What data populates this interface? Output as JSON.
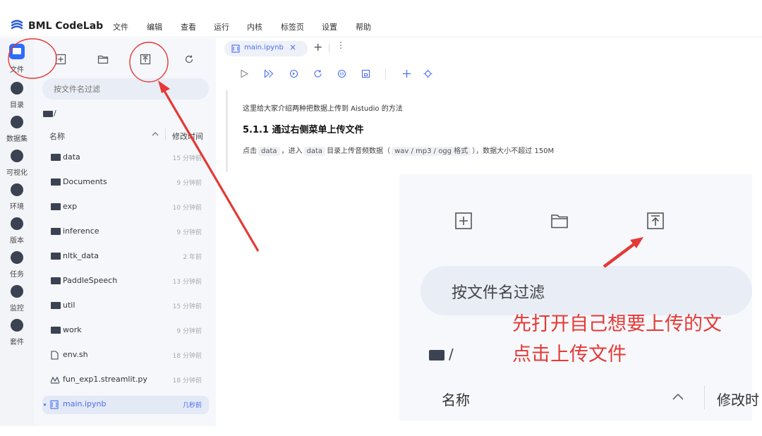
{
  "app": {
    "title": "BML CodeLab"
  },
  "menu": [
    "文件",
    "编辑",
    "查看",
    "运行",
    "内核",
    "标签页",
    "设置",
    "帮助"
  ],
  "rail": [
    {
      "label": "文件",
      "icon": "folder-icon"
    },
    {
      "label": "目录",
      "icon": "toc-icon"
    },
    {
      "label": "数据集",
      "icon": "dataset-icon"
    },
    {
      "label": "可视化",
      "icon": "chart-icon"
    },
    {
      "label": "环境",
      "icon": "environment-icon"
    },
    {
      "label": "版本",
      "icon": "version-icon"
    },
    {
      "label": "任务",
      "icon": "task-icon"
    },
    {
      "label": "监控",
      "icon": "monitor-icon"
    },
    {
      "label": "套件",
      "icon": "suite-icon"
    }
  ],
  "filebrowser": {
    "filter_placeholder": "按文件名过滤",
    "path": "/",
    "col_name": "名称",
    "col_modified": "修改时间",
    "files": [
      {
        "name": "data",
        "time": "15 分钟前",
        "type": "folder"
      },
      {
        "name": "Documents",
        "time": "9 分钟前",
        "type": "folder"
      },
      {
        "name": "exp",
        "time": "10 分钟前",
        "type": "folder"
      },
      {
        "name": "inference",
        "time": "9 分钟前",
        "type": "folder"
      },
      {
        "name": "nltk_data",
        "time": "2 年前",
        "type": "folder"
      },
      {
        "name": "PaddleSpeech",
        "time": "13 分钟前",
        "type": "folder"
      },
      {
        "name": "util",
        "time": "15 分钟前",
        "type": "folder"
      },
      {
        "name": "work",
        "time": "9 分钟前",
        "type": "folder"
      },
      {
        "name": "env.sh",
        "time": "18 分钟前",
        "type": "file"
      },
      {
        "name": "fun_exp1.streamlit.py",
        "time": "18 分钟前",
        "type": "streamlit"
      },
      {
        "name": "main.ipynb",
        "time": "几秒前",
        "type": "notebook"
      }
    ]
  },
  "tab": {
    "label": "main.ipynb"
  },
  "notebook": {
    "intro": "这里给大家介绍两种把数据上传到 Aistudio 的方法",
    "heading": "5.1.1 通过右侧菜单上传文件",
    "desc_1": "点击",
    "desc_code1": "data",
    "desc_2": "，进入",
    "desc_code2": "data",
    "desc_3": "目录上传音频数据（",
    "desc_code3": "wav / mp3 / ogg 格式",
    "desc_4": "），数据大小不超过 150M"
  },
  "embedded": {
    "filter_placeholder": "按文件名过滤",
    "path": "/",
    "annotation_line1": "先打开自己想要上传的文",
    "annotation_line2": "点击上传文件",
    "col_name": "名称",
    "col_modified": "修改时"
  },
  "colors": {
    "accent": "#4a6cf7",
    "annotation": "#e53935",
    "sidebar_bg": "#f5f7fb"
  }
}
